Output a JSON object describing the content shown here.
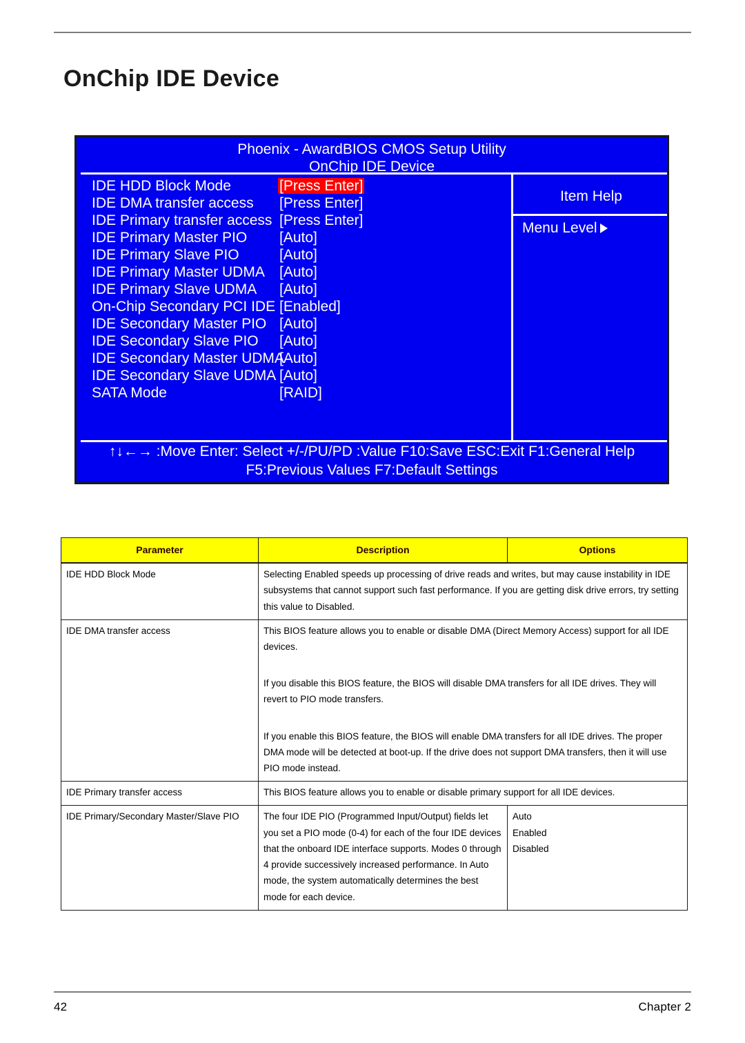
{
  "page": {
    "title": "OnChip IDE Device",
    "number": "42",
    "chapter": "Chapter 2"
  },
  "bios": {
    "title_line1": "Phoenix - AwardBIOS CMOS Setup Utility",
    "title_line2": "OnChip IDE Device",
    "items": [
      {
        "label": "IDE HDD Block Mode",
        "value": "[Press Enter]",
        "selected": true
      },
      {
        "label": "IDE DMA transfer access",
        "value": "[Press Enter]",
        "selected": false
      },
      {
        "label": "IDE Primary transfer access",
        "value": "[Press Enter]",
        "selected": false
      },
      {
        "label": "IDE Primary Master PIO",
        "value": "[Auto]",
        "selected": false
      },
      {
        "label": "IDE Primary Slave   PIO",
        "value": "[Auto]",
        "selected": false
      },
      {
        "label": "IDE Primary Master UDMA",
        "value": "[Auto]",
        "selected": false
      },
      {
        "label": "IDE Primary Slave   UDMA",
        "value": "[Auto]",
        "selected": false
      },
      {
        "label": "On-Chip Secondary PCI IDE",
        "value": "[Enabled]",
        "selected": false
      },
      {
        "label": "IDE Secondary Master PIO",
        "value": "[Auto]",
        "selected": false
      },
      {
        "label": "IDE Secondary Slave   PIO",
        "value": "[Auto]",
        "selected": false
      },
      {
        "label": "IDE Secondary Master UDMA",
        "value": "[Auto]",
        "selected": false
      },
      {
        "label": "IDE Secondary Slave   UDMA",
        "value": "[Auto]",
        "selected": false
      },
      {
        "label": "SATA Mode",
        "value": "[RAID]",
        "selected": false
      }
    ],
    "help": {
      "title": "Item Help",
      "menu_level_label": "Menu Level",
      "menu_level_icon": "triangle-right-icon"
    },
    "footer_line1": "↑↓←→ :Move  Enter: Select   +/-/PU/PD :Value F10:Save  ESC:Exit  F1:General Help",
    "footer_line2": "F5:Previous Values  F7:Default Settings",
    "colors": {
      "screen_background": "#0000f0",
      "selection_background": "#ff0000",
      "text": "#ffffff"
    }
  },
  "param_table": {
    "headers": [
      "Parameter",
      "Description",
      "Options"
    ],
    "header_background": "#ffff00",
    "rows": [
      {
        "parameter": "IDE HDD Block Mode",
        "description": [
          "Selecting Enabled speeds up processing of drive reads and writes, but may cause instability in IDE subsystems that cannot support such fast performance. If you are getting disk drive errors, try setting this value to Disabled."
        ],
        "options": [],
        "desc_colspan": 2
      },
      {
        "parameter": "IDE DMA transfer access",
        "description": [
          "This BIOS feature allows you to enable or disable DMA (Direct Memory Access) support for all IDE devices.",
          "If you disable this BIOS feature, the BIOS will disable DMA transfers for all IDE drives. They will revert to PIO mode transfers.",
          "If you enable this BIOS feature, the BIOS will enable DMA transfers for all IDE drives. The proper DMA mode will be detected at boot-up. If the drive does not support DMA transfers, then it will use PIO mode instead."
        ],
        "options": [],
        "desc_colspan": 2
      },
      {
        "parameter": "IDE Primary transfer access",
        "description": [
          "This BIOS feature allows you to enable or disable primary support for all IDE devices."
        ],
        "options": [],
        "desc_colspan": 2
      },
      {
        "parameter": "IDE Primary/Secondary Master/Slave PIO",
        "description": [
          "The four IDE PIO (Programmed Input/Output) fields let you set a PIO mode (0-4) for each of the four IDE devices that the onboard IDE interface supports. Modes 0 through 4 provide successively increased performance. In Auto mode, the system automatically determines the best mode for each device."
        ],
        "options": [
          "Auto",
          "Enabled",
          "Disabled"
        ],
        "desc_colspan": 1
      }
    ]
  }
}
